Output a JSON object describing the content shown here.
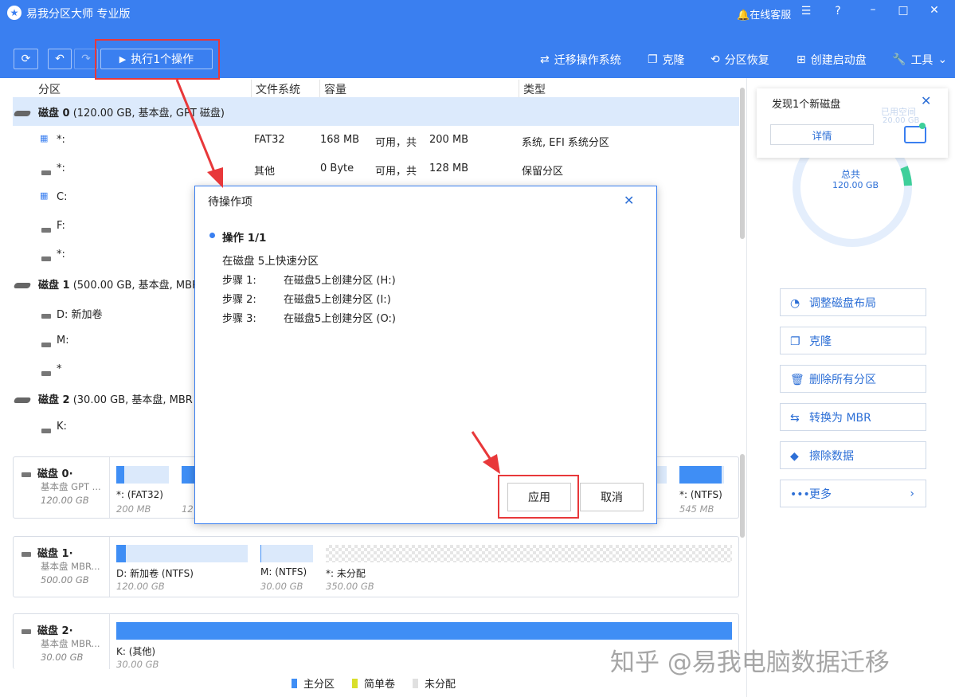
{
  "app": {
    "title": "易我分区大师 专业版"
  },
  "titlebar": {
    "support": "在线客服"
  },
  "toolbar": {
    "execute_label": "执行1个操作",
    "migrate_os": "迁移操作系统",
    "clone": "克隆",
    "recover": "分区恢复",
    "boot_disk": "创建启动盘",
    "tools": "工具"
  },
  "table": {
    "headers": [
      "分区",
      "文件系统",
      "容量",
      "类型"
    ],
    "disk0": {
      "name": "磁盘 0",
      "detail": "(120.00 GB, 基本盘, GPT 磁盘)"
    },
    "disk0_rows": [
      {
        "name": "*:",
        "fs": "FAT32",
        "size": "168 MB",
        "avail": "可用，共",
        "total": "200 MB",
        "type": "系统, EFI 系统分区"
      },
      {
        "name": "*:",
        "fs": "其他",
        "size": "0 Byte",
        "avail": "可用，共",
        "total": "128 MB",
        "type": "保留分区"
      },
      {
        "name": "C:"
      },
      {
        "name": "F:"
      },
      {
        "name": "*:"
      }
    ],
    "disk1": {
      "name": "磁盘 1",
      "detail": "(500.00 GB, 基本盘, MBR"
    },
    "disk1_rows": [
      {
        "name": "D: 新加卷"
      },
      {
        "name": "M:"
      },
      {
        "name": "*"
      }
    ],
    "disk2": {
      "name": "磁盘 2",
      "detail": "(30.00 GB, 基本盘, MBR"
    },
    "disk2_rows": [
      {
        "name": "K:"
      }
    ]
  },
  "map": {
    "disk0": {
      "title": "磁盘 0·",
      "sub": "基本盘 GPT ...",
      "size": "120.00 GB",
      "p1_label": "*: (FAT32)",
      "p1_size": "200 MB",
      "p2_size": "12",
      "plast_label": "*: (NTFS)",
      "plast_size": "545 MB"
    },
    "disk1": {
      "title": "磁盘 1·",
      "sub": "基本盘 MBR...",
      "size": "500.00 GB",
      "p1_label": "D: 新加卷 (NTFS)",
      "p1_size": "120.00 GB",
      "p2_label": "M: (NTFS)",
      "p2_size": "30.00 GB",
      "p3_label": "*: 未分配",
      "p3_size": "350.00 GB"
    },
    "disk2": {
      "title": "磁盘 2·",
      "sub": "基本盘 MBR...",
      "size": "30.00 GB",
      "p1_label": "K: (其他)",
      "p1_size": "30.00 GB"
    }
  },
  "legend": {
    "primary": "主分区",
    "simple": "简单卷",
    "unallocated": "未分配"
  },
  "notice": {
    "title": "发现1个新磁盘",
    "detail_button": "详情",
    "ghost1": "已用空间",
    "ghost2": "20.00 GB"
  },
  "donut": {
    "label": "总共",
    "value": "120.00 GB"
  },
  "right_actions": [
    "调整磁盘布局",
    "克隆",
    "删除所有分区",
    "转换为 MBR",
    "擦除数据",
    "更多"
  ],
  "dialog": {
    "title": "待操作项",
    "op_header": "操作 1/1",
    "op_desc": "在磁盘 5上快速分区",
    "steps": [
      {
        "label": "步骤 1:",
        "text": "在磁盘5上创建分区 (H:)"
      },
      {
        "label": "步骤 2:",
        "text": "在磁盘5上创建分区 (I:)"
      },
      {
        "label": "步骤 3:",
        "text": "在磁盘5上创建分区 (O:)"
      }
    ],
    "apply": "应用",
    "cancel": "取消"
  },
  "watermark": "知乎 @易我电脑数据迁移",
  "colors": {
    "brand": "#3a7ff0",
    "primary_partition": "#3f8ef5",
    "highlight": "#e8383a",
    "selected_row": "#dceafc"
  }
}
